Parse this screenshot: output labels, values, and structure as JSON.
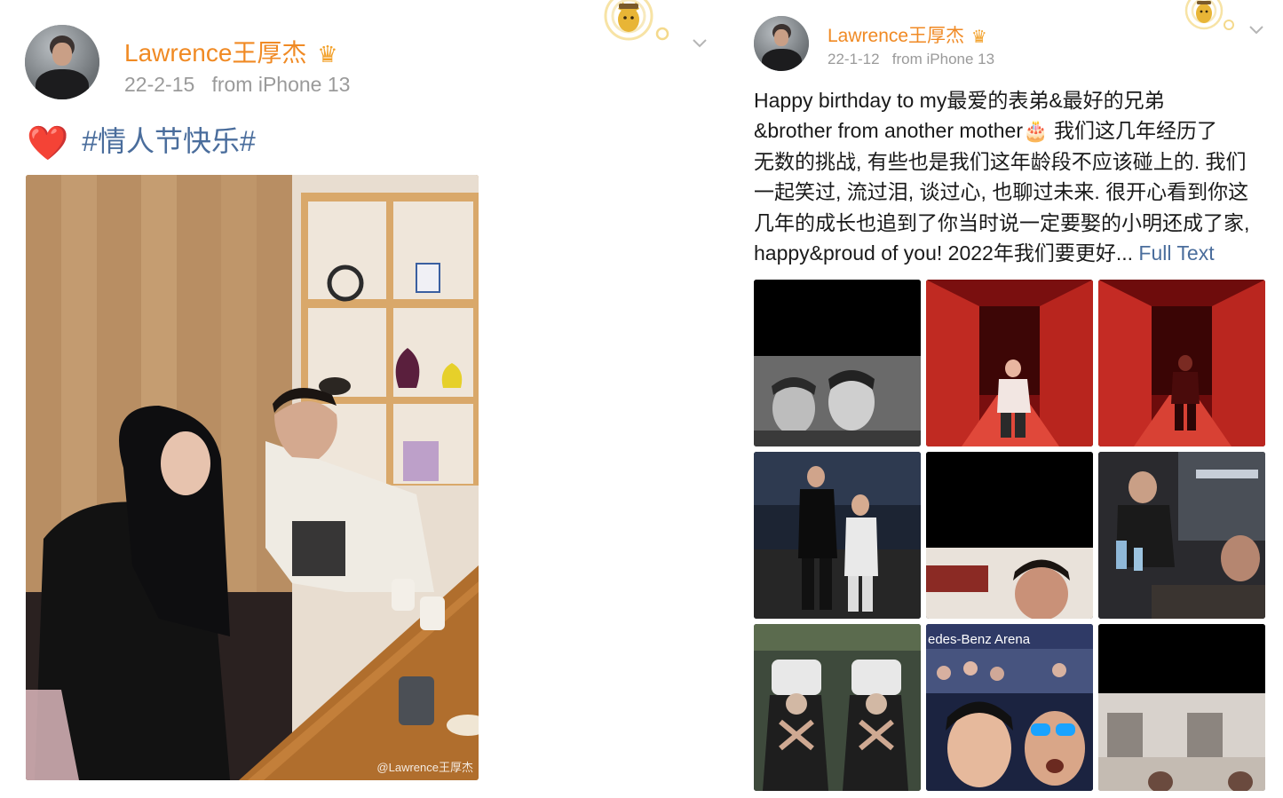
{
  "post_left": {
    "username": "Lawrence王厚杰",
    "crown_icon": "crown-icon",
    "date": "22-2-15",
    "source": "from iPhone 13",
    "emoji": "❤️",
    "topic": "#情人节快乐#",
    "photo_watermark": "@Lawrence王厚杰"
  },
  "post_right": {
    "username": "Lawrence王厚杰",
    "crown_icon": "crown-icon",
    "date": "22-1-12",
    "source": "from iPhone 13",
    "text_main": "Happy birthday to my最爱的表弟&最好的兄弟\n&brother from another mother🎂 我们这几年经历了\n无数的挑战, 有些也是我们这年龄段不应该碰上的. 我们\n一起笑过, 流过泪, 谈过心, 也聊过未来. 很开心看到你这\n几年的成长也追到了你当时说一定要娶的小明还成了家,\nhappy&proud of you! 2022年我们要更好... ",
    "full_text_link": "Full Text",
    "arena_sign": "edes-Benz  Arena"
  },
  "colors": {
    "username": "#f08a24",
    "topic_link": "#4a6d9c",
    "meta": "#9a9a9a",
    "heart": "#d81e1e"
  }
}
